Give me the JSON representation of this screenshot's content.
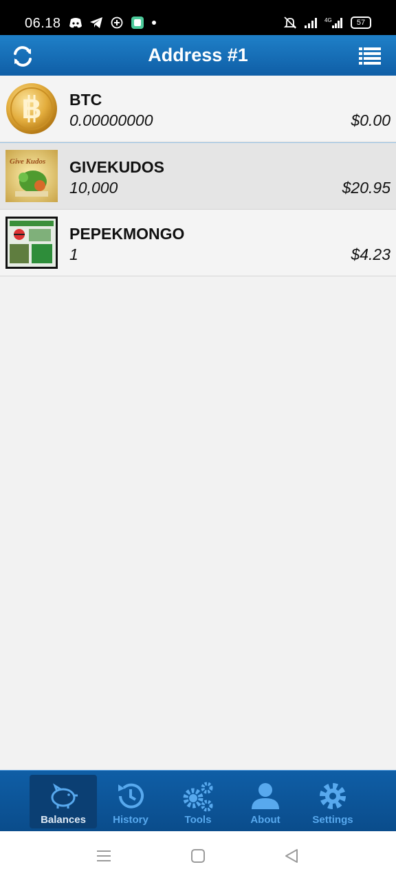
{
  "status_bar": {
    "time": "06.18",
    "battery": "57",
    "network": "4G",
    "icons_left": [
      "discord-icon",
      "telegram-icon",
      "plus-circle-icon",
      "app-icon",
      "dot-icon"
    ],
    "icons_right": [
      "mute-bell-icon",
      "signal-icon",
      "signal-4g-icon",
      "battery-icon"
    ]
  },
  "header": {
    "title": "Address #1",
    "left_icon": "refresh-icon",
    "right_icon": "list-menu-icon",
    "color_top": "#1f80c8",
    "color_bottom": "#0f5ea6"
  },
  "assets": [
    {
      "name": "BTC",
      "quantity": "0.00000000",
      "usd": "$0.00",
      "icon": "bitcoin-coin-icon"
    },
    {
      "name": "GIVEKUDOS",
      "quantity": "10,000",
      "usd": "$20.95",
      "icon": "givekudos-card-image",
      "selected": true
    },
    {
      "name": "PEPEKMONGO",
      "quantity": "1",
      "usd": "$4.23",
      "icon": "pepekmongo-card-image"
    }
  ],
  "bottom_nav": {
    "tabs": [
      {
        "label": "Balances",
        "icon": "piggy-bank-icon",
        "active": true
      },
      {
        "label": "History",
        "icon": "history-icon"
      },
      {
        "label": "Tools",
        "icon": "gears-icon"
      },
      {
        "label": "About",
        "icon": "user-icon"
      },
      {
        "label": "Settings",
        "icon": "gear-icon"
      }
    ],
    "accent": "#58a9ee"
  },
  "system_nav": [
    "menu-icon",
    "home-icon",
    "back-icon"
  ]
}
